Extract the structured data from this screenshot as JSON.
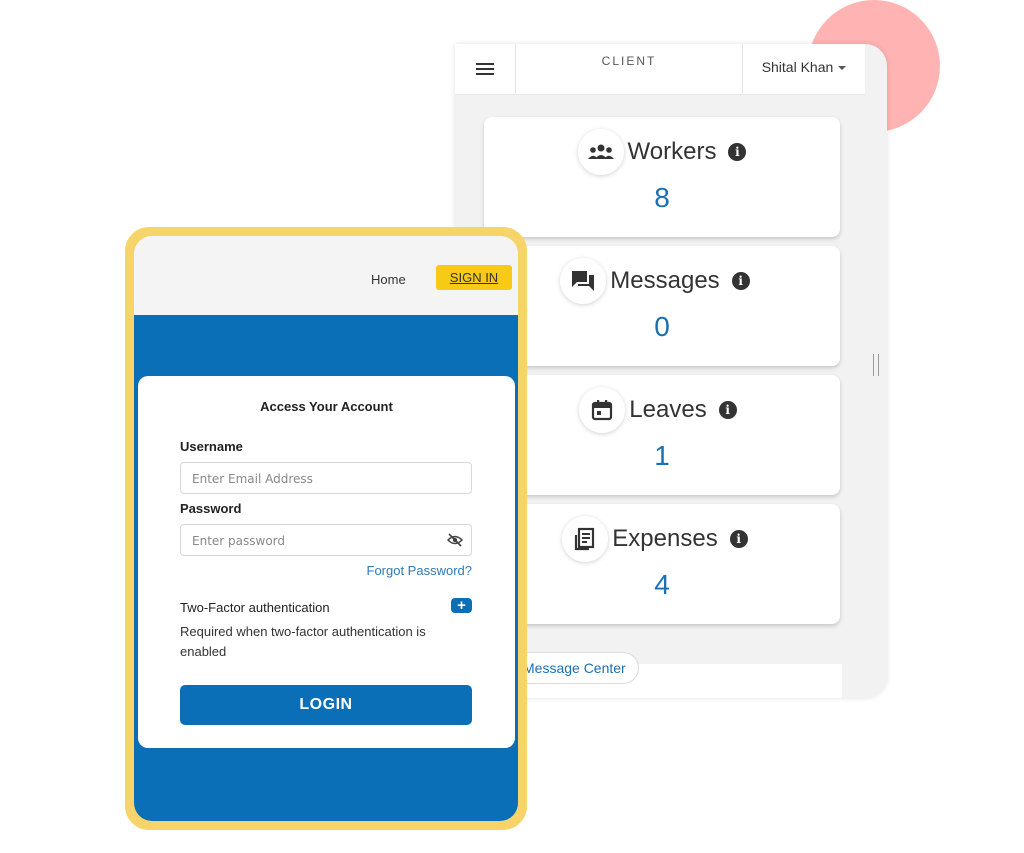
{
  "dashboard": {
    "header_label": "CLIENT",
    "user_name": "Shital Khan",
    "cards": [
      {
        "title": "Workers",
        "value": "8",
        "icon": "people-group-icon"
      },
      {
        "title": "Messages",
        "value": "0",
        "icon": "chat-bubbles-icon"
      },
      {
        "title": "Leaves",
        "value": "1",
        "icon": "calendar-icon"
      },
      {
        "title": "Expenses",
        "value": "4",
        "icon": "receipt-icon"
      }
    ],
    "message_center_label": "Message Center"
  },
  "login": {
    "nav_home": "Home",
    "nav_signin": "SIGN IN",
    "form_title": "Access Your Account",
    "username_label": "Username",
    "username_placeholder": "Enter Email Address",
    "password_label": "Password",
    "password_placeholder": "Enter password",
    "forgot_password": "Forgot Password?",
    "tfa_label": "Two-Factor authentication",
    "tfa_description": "Required when two-factor authentication is enabled",
    "login_button": "LOGIN"
  },
  "colors": {
    "accent_blue": "#0b6fb8",
    "value_blue": "#1a6fb5",
    "signin_yellow": "#f7cb15",
    "phone_border": "#f7d46a",
    "decor_pink": "#ffb3b3"
  }
}
